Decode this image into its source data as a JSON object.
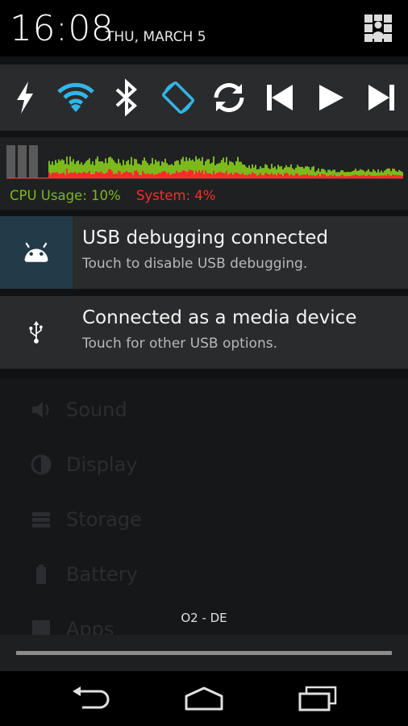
{
  "header": {
    "time": "16:08",
    "date": "THU, MARCH 5",
    "settings_icon": "quick-settings-icon"
  },
  "power_widget": {
    "buttons": [
      {
        "icon": "flashlight-icon",
        "color": "#ffffff"
      },
      {
        "icon": "wifi-icon",
        "color": "#33b5e5"
      },
      {
        "icon": "bluetooth-icon",
        "color": "#ffffff"
      },
      {
        "icon": "auto-rotate-icon",
        "color": "#33b5e5"
      },
      {
        "icon": "sync-icon",
        "color": "#ffffff"
      },
      {
        "icon": "media-previous-icon",
        "color": "#ffffff"
      },
      {
        "icon": "media-play-icon",
        "color": "#ffffff"
      },
      {
        "icon": "media-next-icon",
        "color": "#ffffff"
      }
    ]
  },
  "cpu_widget": {
    "usage_label": "CPU Usage: 10%",
    "system_label": "System: 4%",
    "usage_color": "#7cba1c",
    "system_color": "#ff2b2b"
  },
  "notifications": [
    {
      "title": "USB debugging connected",
      "subtitle": "Touch to disable USB debugging.",
      "icon": "android-icon",
      "icon_bg": "#233a48"
    },
    {
      "title": "Connected as a media device",
      "subtitle": "Touch for other USB options.",
      "icon": "usb-icon",
      "icon_bg": "#2a2b2d"
    }
  ],
  "background_settings": {
    "items": [
      {
        "label": "Sound",
        "icon": "sound-icon"
      },
      {
        "label": "Display",
        "icon": "display-icon"
      },
      {
        "label": "Storage",
        "icon": "storage-icon"
      },
      {
        "label": "Battery",
        "icon": "battery-icon"
      },
      {
        "label": "Apps",
        "icon": "apps-icon"
      }
    ]
  },
  "carrier": "O2 - DE",
  "navbar": {
    "back_icon": "back-icon",
    "home_icon": "home-icon",
    "recents_icon": "recents-icon"
  }
}
